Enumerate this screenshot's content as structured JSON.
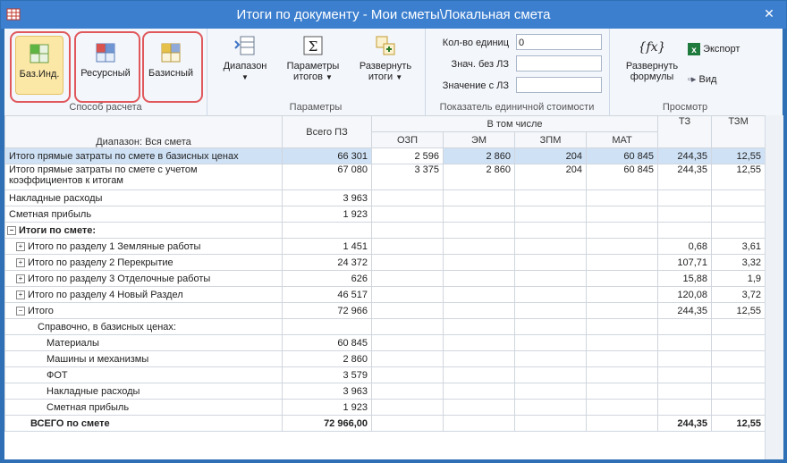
{
  "window": {
    "title": "Итоги по документу - Мои сметы\\Локальная смета",
    "close_label": "✕"
  },
  "ribbon": {
    "calc_group": {
      "label": "Способ расчета",
      "buttons": [
        {
          "label": "Баз.Инд."
        },
        {
          "label": "Ресурсный"
        },
        {
          "label": "Базисный"
        }
      ]
    },
    "params_group": {
      "label": "Параметры",
      "range_label": "Диапазон",
      "totals_params_label": "Параметры итогов",
      "expand_totals_label": "Развернуть итоги"
    },
    "unit_cost_group": {
      "label": "Показатель единичной стоимости",
      "fields": [
        {
          "label": "Кол-во единиц",
          "value": "0"
        },
        {
          "label": "Знач. без ЛЗ",
          "value": ""
        },
        {
          "label": "Значение с ЛЗ",
          "value": ""
        }
      ]
    },
    "view_group": {
      "label": "Просмотр",
      "expand_formulas_label": "Развернуть формулы",
      "export_label": "Экспорт",
      "view_label": "Вид"
    }
  },
  "grid": {
    "header": {
      "range": "Диапазон: Вся смета",
      "total": "Всего ПЗ",
      "including": "В том числе",
      "ozp": "ОЗП",
      "em": "ЭМ",
      "zpm": "ЗПМ",
      "mat": "МАТ",
      "tz": "ТЗ",
      "tzm": "ТЗМ"
    },
    "rows": [
      {
        "name": "Итого прямые затраты по смете в базисных ценах",
        "total": "66 301",
        "ozp": "2 596",
        "em": "2 860",
        "zpm": "204",
        "mat": "60 845",
        "tz": "244,35",
        "tzm": "12,55"
      },
      {
        "name": "Итого прямые затраты по смете с учетом",
        "name2": "коэффициентов к итогам",
        "total": "67 080",
        "ozp": "3 375",
        "em": "2 860",
        "zpm": "204",
        "mat": "60 845",
        "tz": "244,35",
        "tzm": "12,55"
      },
      {
        "name": "Накладные расходы",
        "total": "3 963",
        "ozp": "",
        "em": "",
        "zpm": "",
        "mat": "",
        "tz": "",
        "tzm": ""
      },
      {
        "name": "Сметная прибыль",
        "total": "1 923",
        "ozp": "",
        "em": "",
        "zpm": "",
        "mat": "",
        "tz": "",
        "tzm": ""
      },
      {
        "name": "Итоги по смете:",
        "total": "",
        "ozp": "",
        "em": "",
        "zpm": "",
        "mat": "",
        "tz": "",
        "tzm": ""
      },
      {
        "name": "Итого по разделу 1 Земляные работы",
        "total": "1 451",
        "ozp": "",
        "em": "",
        "zpm": "",
        "mat": "",
        "tz": "0,68",
        "tzm": "3,61"
      },
      {
        "name": "Итого по разделу 2 Перекрытие",
        "total": "24 372",
        "ozp": "",
        "em": "",
        "zpm": "",
        "mat": "",
        "tz": "107,71",
        "tzm": "3,32"
      },
      {
        "name": "Итого по разделу 3 Отделочные работы",
        "total": "626",
        "ozp": "",
        "em": "",
        "zpm": "",
        "mat": "",
        "tz": "15,88",
        "tzm": "1,9"
      },
      {
        "name": "Итого по разделу 4 Новый Раздел",
        "total": "46 517",
        "ozp": "",
        "em": "",
        "zpm": "",
        "mat": "",
        "tz": "120,08",
        "tzm": "3,72"
      },
      {
        "name": "Итого",
        "total": "72 966",
        "ozp": "",
        "em": "",
        "zpm": "",
        "mat": "",
        "tz": "244,35",
        "tzm": "12,55"
      },
      {
        "name": "Справочно, в базисных ценах:",
        "total": "",
        "ozp": "",
        "em": "",
        "zpm": "",
        "mat": "",
        "tz": "",
        "tzm": ""
      },
      {
        "name": "Материалы",
        "total": "60 845",
        "ozp": "",
        "em": "",
        "zpm": "",
        "mat": "",
        "tz": "",
        "tzm": ""
      },
      {
        "name": "Машины и механизмы",
        "total": "2 860",
        "ozp": "",
        "em": "",
        "zpm": "",
        "mat": "",
        "tz": "",
        "tzm": ""
      },
      {
        "name": "ФОТ",
        "total": "3 579",
        "ozp": "",
        "em": "",
        "zpm": "",
        "mat": "",
        "tz": "",
        "tzm": ""
      },
      {
        "name": "Накладные расходы",
        "total": "3 963",
        "ozp": "",
        "em": "",
        "zpm": "",
        "mat": "",
        "tz": "",
        "tzm": ""
      },
      {
        "name": "Сметная прибыль",
        "total": "1 923",
        "ozp": "",
        "em": "",
        "zpm": "",
        "mat": "",
        "tz": "",
        "tzm": ""
      },
      {
        "name": "ВСЕГО по смете",
        "total": "72 966,00",
        "ozp": "",
        "em": "",
        "zpm": "",
        "mat": "",
        "tz": "244,35",
        "tzm": "12,55"
      }
    ]
  }
}
